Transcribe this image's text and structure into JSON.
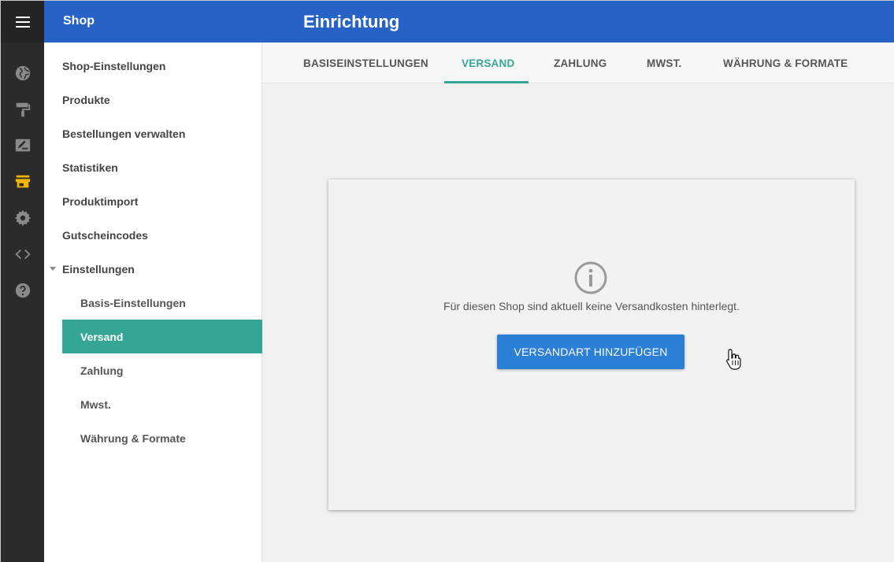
{
  "header": {
    "shop_title": "Shop",
    "page_title": "Einrichtung",
    "color": "#2762c6"
  },
  "rail": {
    "icons": [
      "menu-icon",
      "globe-icon",
      "paint-roller-icon",
      "edit-icon",
      "store-icon",
      "gear-icon",
      "code-icon",
      "help-icon"
    ],
    "active_icon": "store-icon",
    "active_color": "#f5b400"
  },
  "nav": {
    "items": [
      {
        "label": "Shop-Einstellungen"
      },
      {
        "label": "Produkte"
      },
      {
        "label": "Bestellungen verwalten"
      },
      {
        "label": "Statistiken"
      },
      {
        "label": "Produktimport"
      },
      {
        "label": "Gutscheincodes"
      },
      {
        "label": "Einstellungen"
      }
    ],
    "sub_items": [
      {
        "label": "Basis-Einstellungen"
      },
      {
        "label": "Versand"
      },
      {
        "label": "Zahlung"
      },
      {
        "label": "Mwst."
      },
      {
        "label": "Währung & Formate"
      }
    ],
    "active_sub": "Versand",
    "accent": "#35a595"
  },
  "tabs": [
    {
      "label": "BASISEINSTELLUNGEN"
    },
    {
      "label": "VERSAND"
    },
    {
      "label": "ZAHLUNG"
    },
    {
      "label": "MWST."
    },
    {
      "label": "WÄHRUNG & FORMATE"
    }
  ],
  "active_tab": "VERSAND",
  "empty_state": {
    "icon": "info-icon",
    "message": "Für diesen Shop sind aktuell keine Versandkosten hinterlegt.",
    "button_label": "VERSANDART HINZUFÜGEN",
    "button_color": "#2b7fd4"
  }
}
